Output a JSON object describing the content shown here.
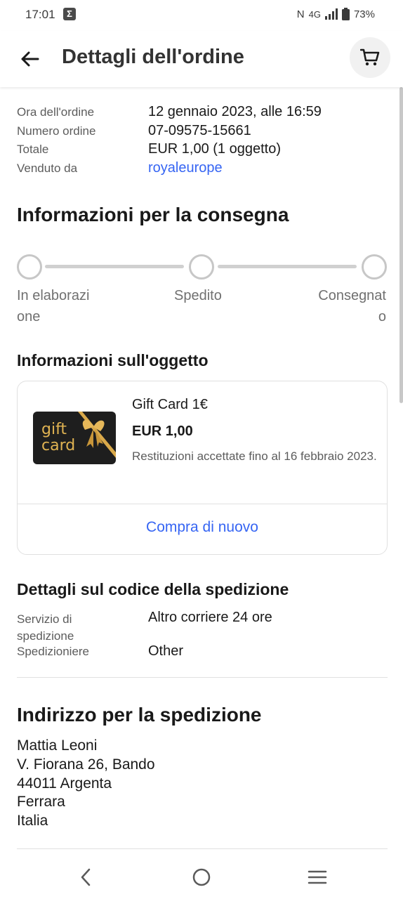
{
  "status_bar": {
    "time": "17:01",
    "app_icon": "Σ",
    "nfc": "N",
    "network": "4G",
    "battery": "73%"
  },
  "header": {
    "title": "Dettagli dell'ordine",
    "back_icon": "arrow-left-icon",
    "cart_icon": "cart-icon"
  },
  "order": {
    "rows": [
      {
        "label": "Ora dell'ordine",
        "value": "12 gennaio 2023, alle 16:59"
      },
      {
        "label": "Numero ordine",
        "value": "07-09575-15661"
      },
      {
        "label": "Totale",
        "value": "EUR 1,00 (1 oggetto)"
      },
      {
        "label": "Venduto da",
        "value": "royaleurope"
      }
    ]
  },
  "delivery": {
    "title": "Informazioni per la consegna",
    "steps": [
      {
        "line1": "In elaborazi",
        "line2": "one"
      },
      {
        "line1": "Spedito",
        "line2": ""
      },
      {
        "line1": "Consegnat",
        "line2": "o"
      }
    ]
  },
  "item": {
    "section_title": "Informazioni sull'oggetto",
    "image_text_1": "gift",
    "image_text_2": "card",
    "title": "Gift Card 1€",
    "price": "EUR 1,00",
    "returns": " Restituzioni accettate fino al 16 febbraio 2023.",
    "buy_again": "Compra di nuovo"
  },
  "shipping": {
    "title": "Dettagli sul codice della spedizione",
    "service_label_1": "Servizio di",
    "service_label_2": "spedizione",
    "service_value": "Altro corriere 24 ore",
    "carrier_label": "Spedizioniere",
    "carrier_value": "Other"
  },
  "address": {
    "title": "Indirizzo per la spedizione",
    "lines": [
      "Mattia Leoni",
      "V. Fiorana 26, Bando",
      "44011 Argenta",
      "Ferrara",
      "Italia"
    ]
  },
  "colors": {
    "link": "#3665f3",
    "label": "#5c5c5c",
    "text": "#191919"
  }
}
